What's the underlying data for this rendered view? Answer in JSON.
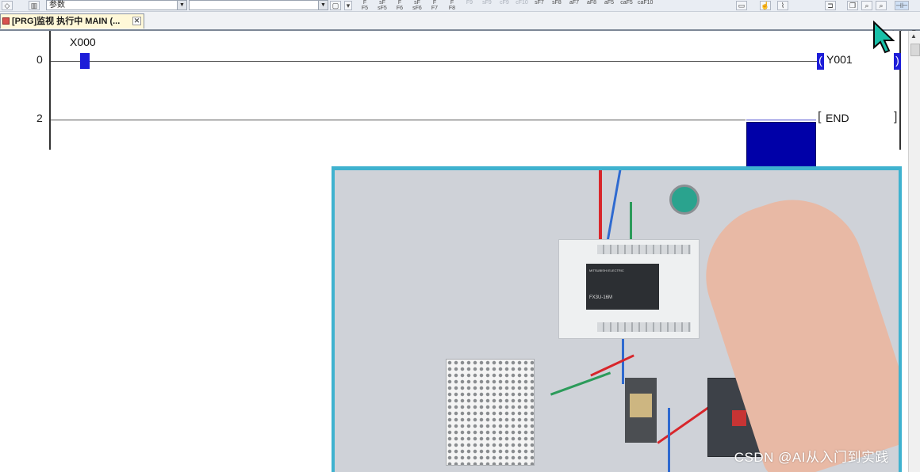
{
  "toolbar": {
    "combo1_value": "",
    "combo2_value": "参数",
    "combo3_value": "",
    "fkeys": [
      {
        "top": "F",
        "bottom": "F5"
      },
      {
        "top": "sF",
        "bottom": "sF5"
      },
      {
        "top": "F",
        "bottom": "F6"
      },
      {
        "top": "sF",
        "bottom": "sF6"
      },
      {
        "top": "F",
        "bottom": "F7"
      },
      {
        "top": "F",
        "bottom": "F8"
      },
      {
        "top": "",
        "bottom": "F9"
      },
      {
        "top": "",
        "bottom": "sF9"
      },
      {
        "top": "",
        "bottom": "cF9"
      },
      {
        "top": "",
        "bottom": "cF10"
      },
      {
        "top": "",
        "bottom": "sF7"
      },
      {
        "top": "",
        "bottom": "sF8"
      },
      {
        "top": "",
        "bottom": "aF7"
      },
      {
        "top": "",
        "bottom": "aF8"
      },
      {
        "top": "",
        "bottom": "aF5"
      },
      {
        "top": "",
        "bottom": "caF5"
      },
      {
        "top": "",
        "bottom": "caF10"
      }
    ]
  },
  "tab": {
    "label": "[PRG]监视 执行中 MAIN (...",
    "close": "✕"
  },
  "ladder": {
    "rungs": [
      {
        "step": "0",
        "contact": "X000",
        "coil": "Y001"
      },
      {
        "step": "2",
        "instruction": "END"
      }
    ]
  },
  "photo": {
    "plc_model": "FX3U-16M",
    "plc_brand": "MITSUBISHI ELECTRIC"
  },
  "watermark": "CSDN @AI从入门到实践",
  "colors": {
    "contact_fill": "#1d1dd8",
    "cursor_block": "#0000a8",
    "photo_border": "#3fb2cf",
    "tab_bg": "#fff8d8"
  }
}
